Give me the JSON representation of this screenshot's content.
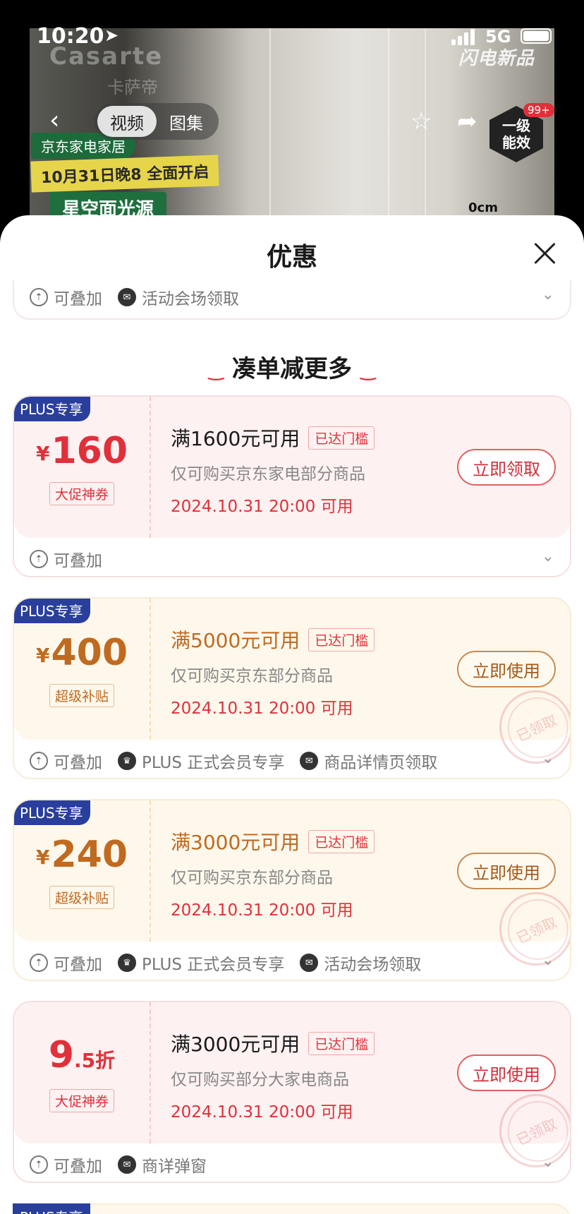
{
  "status_bar": {
    "time": "10:20",
    "network": "5G"
  },
  "preview": {
    "brand": "Casarte",
    "brand_sub": "卡萨帝",
    "promo_tag1": "京东家电家居",
    "promo_tag2": "10月31日晚8 全面开启",
    "promo_tag3": "星空面光源",
    "flash_logo": "闪电新品",
    "energy_badge": "一级 能效",
    "energy_count": "99+",
    "measure": "0cm",
    "tabs": [
      {
        "label": "视频",
        "active": true
      },
      {
        "label": "图集",
        "active": false
      }
    ]
  },
  "sheet": {
    "title": "优惠",
    "partial_row": {
      "stack": "可叠加",
      "source": "活动会场领取"
    },
    "section_heading": "凑单减更多",
    "coupons": [
      {
        "plus_tag": "PLUS专享",
        "currency": "¥",
        "amount": "160",
        "kind": "大促神券",
        "condition": "满1600元可用",
        "reached": "已达门槛",
        "scope": "仅可购买京东家电部分商品",
        "time": "2024.10.31 20:00 可用",
        "button": "立即领取",
        "foot": {
          "stack": "可叠加"
        }
      },
      {
        "plus_tag": "PLUS专享",
        "currency": "¥",
        "amount": "400",
        "kind": "超级补贴",
        "condition": "满5000元可用",
        "reached": "已达门槛",
        "scope": "仅可购买京东部分商品",
        "time": "2024.10.31 20:00 可用",
        "button": "立即使用",
        "stamp": "已领取",
        "foot": {
          "stack": "可叠加",
          "member": "PLUS 正式会员专享",
          "source": "商品详情页领取"
        }
      },
      {
        "plus_tag": "PLUS专享",
        "currency": "¥",
        "amount": "240",
        "kind": "超级补贴",
        "condition": "满3000元可用",
        "reached": "已达门槛",
        "scope": "仅可购买京东部分商品",
        "time": "2024.10.31 20:00 可用",
        "button": "立即使用",
        "stamp": "已领取",
        "foot": {
          "stack": "可叠加",
          "member": "PLUS 正式会员专享",
          "source": "活动会场领取"
        }
      },
      {
        "amount_main": "9",
        "amount_small": ".5折",
        "kind": "大促神券",
        "condition": "满3000元可用",
        "reached": "已达门槛",
        "scope": "仅可购买部分大家电商品",
        "time": "2024.10.31 20:00 可用",
        "button": "立即使用",
        "stamp": "已领取",
        "foot": {
          "stack": "可叠加",
          "source": "商详弹窗"
        }
      }
    ],
    "next_hint_tag": "PLUS专享"
  },
  "colors": {
    "accent_red": "#e0303a",
    "gold": "#c06a20",
    "plus_blue": "#2a3f9c"
  }
}
